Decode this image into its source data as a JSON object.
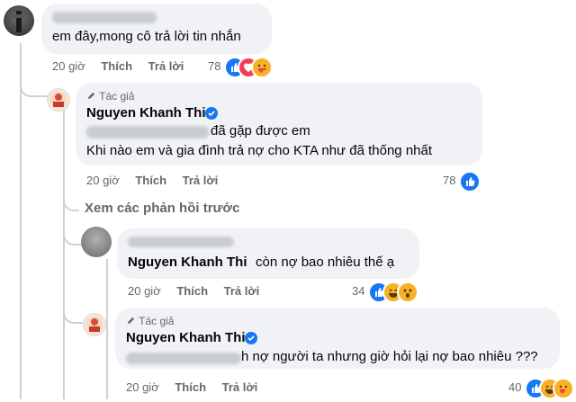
{
  "comment1": {
    "text": "em đây,mong cô trả lời tin nhắn",
    "time": "20 giờ",
    "like": "Thích",
    "reply": "Trả lời",
    "reaction_count": "78"
  },
  "reply1": {
    "author_tag": "Tác giả",
    "author": "Nguyen Khanh Thi",
    "line1": "đã gặp được em",
    "line2": "Khi nào em và gia đình trả nợ cho KTA như đã thống nhất",
    "time": "20 giờ",
    "like": "Thích",
    "reply": "Trả lời",
    "reaction_count": "78"
  },
  "view_previous": "Xem các phản hồi trước",
  "reply2": {
    "mention": "Nguyen Khanh Thi",
    "text": "còn nợ bao nhiêu thế ạ",
    "time": "20 giờ",
    "like": "Thích",
    "reply": "Trả lời",
    "reaction_count": "34"
  },
  "reply3": {
    "author_tag": "Tác giả",
    "author": "Nguyen Khanh Thi",
    "text": "h nợ người ta nhưng giờ hỏi lại nợ bao nhiêu ???",
    "time": "20 giờ",
    "like": "Thích",
    "reply": "Trả lời",
    "reaction_count": "40"
  },
  "colors": {
    "like_blue": "#1877f2",
    "love_red": "#f33e58",
    "haha_yellow": "#f7b125",
    "bubble_bg": "#f0f2f5",
    "meta_gray": "#65676b"
  },
  "icons": [
    "like-icon",
    "love-icon",
    "care-icon",
    "haha-icon",
    "wow-icon",
    "verified-icon",
    "pen-icon"
  ]
}
